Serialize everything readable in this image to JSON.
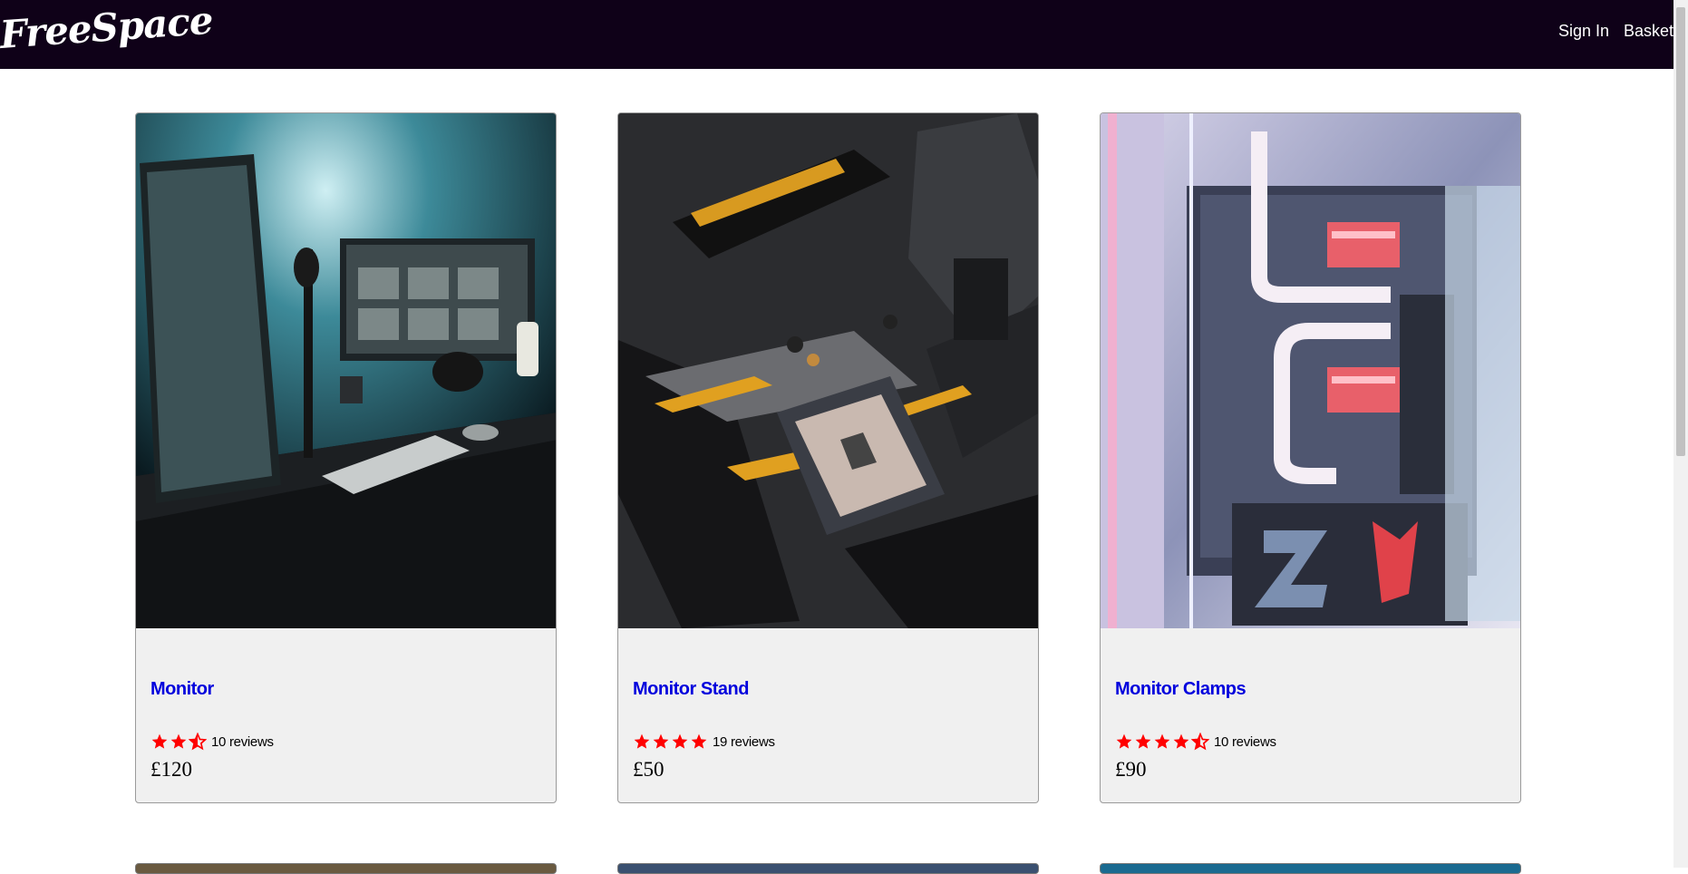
{
  "header": {
    "logo": "FreeSpace",
    "sign_in_label": "Sign In",
    "basket_label": "Basket"
  },
  "products": [
    {
      "title": "Monitor",
      "rating": 2.5,
      "reviews": "10 reviews",
      "price": "£120",
      "image": "desk-setup-with-monitors-photo"
    },
    {
      "title": "Monitor Stand",
      "rating": 4,
      "reviews": "19 reviews",
      "price": "£50",
      "image": "motherboard-cpu-socket-photo"
    },
    {
      "title": "Monitor Clamps",
      "rating": 4.5,
      "reviews": "10 reviews",
      "price": "£90",
      "image": "watercooled-pc-interior-photo"
    }
  ],
  "colors": {
    "navbar": "#0f0118",
    "link": "#0000dd",
    "star": "#ff0000",
    "card_bg": "#f0f0f0"
  }
}
